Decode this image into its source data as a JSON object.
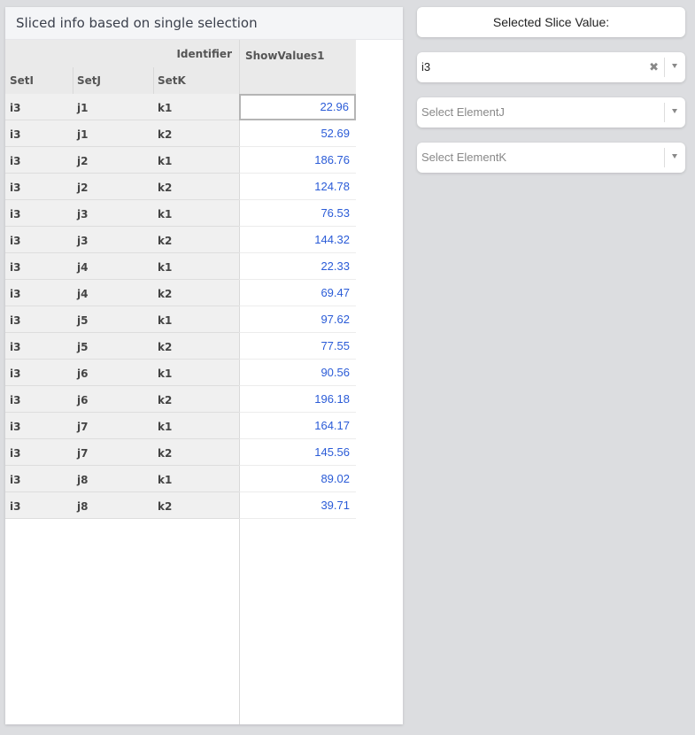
{
  "panel": {
    "title": "Sliced info based on single selection"
  },
  "table": {
    "identifier_label": "Identifier",
    "columns": [
      "SetI",
      "SetJ",
      "SetK"
    ],
    "value_header": "ShowValues1",
    "rows": [
      {
        "i": "i3",
        "j": "j1",
        "k": "k1",
        "v": "22.96"
      },
      {
        "i": "i3",
        "j": "j1",
        "k": "k2",
        "v": "52.69"
      },
      {
        "i": "i3",
        "j": "j2",
        "k": "k1",
        "v": "186.76"
      },
      {
        "i": "i3",
        "j": "j2",
        "k": "k2",
        "v": "124.78"
      },
      {
        "i": "i3",
        "j": "j3",
        "k": "k1",
        "v": "76.53"
      },
      {
        "i": "i3",
        "j": "j3",
        "k": "k2",
        "v": "144.32"
      },
      {
        "i": "i3",
        "j": "j4",
        "k": "k1",
        "v": "22.33"
      },
      {
        "i": "i3",
        "j": "j4",
        "k": "k2",
        "v": "69.47"
      },
      {
        "i": "i3",
        "j": "j5",
        "k": "k1",
        "v": "97.62"
      },
      {
        "i": "i3",
        "j": "j5",
        "k": "k2",
        "v": "77.55"
      },
      {
        "i": "i3",
        "j": "j6",
        "k": "k1",
        "v": "90.56"
      },
      {
        "i": "i3",
        "j": "j6",
        "k": "k2",
        "v": "196.18"
      },
      {
        "i": "i3",
        "j": "j7",
        "k": "k1",
        "v": "164.17"
      },
      {
        "i": "i3",
        "j": "j7",
        "k": "k2",
        "v": "145.56"
      },
      {
        "i": "i3",
        "j": "j8",
        "k": "k1",
        "v": "89.02"
      },
      {
        "i": "i3",
        "j": "j8",
        "k": "k2",
        "v": "39.71"
      }
    ]
  },
  "controls": {
    "slice_title": "Selected Slice Value:",
    "select_i": {
      "value": "i3",
      "icons": [
        "clear-icon",
        "chevron-down-icon"
      ]
    },
    "select_j": {
      "placeholder": "Select ElementJ"
    },
    "select_k": {
      "placeholder": "Select ElementK"
    }
  },
  "colors": {
    "value_text": "#2a5bd7",
    "background": "#dcdde0"
  }
}
